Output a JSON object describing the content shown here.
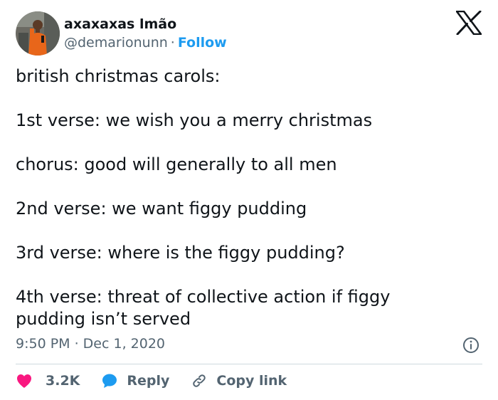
{
  "author": {
    "display_name": "axaxaxas lmão",
    "handle": "@demarionunn",
    "separator": "·",
    "follow_label": "Follow",
    "avatar": "avatar-photo-person-orange-jacket"
  },
  "logo": "x-logo-icon",
  "tweet": {
    "text": "british christmas carols:\n\n1st verse: we wish you a merry christmas\n\nchorus: good will generally to all men\n\n2nd verse: we want figgy pudding\n\n3rd verse: where is the figgy pudding?\n\n4th verse: threat of collective action if figgy\npudding isn’t served",
    "timestamp": "9:50 PM · Dec 1, 2020"
  },
  "actions": {
    "like_count": "3.2K",
    "reply_label": "Reply",
    "copy_link_label": "Copy link"
  },
  "colors": {
    "accent": "#1d9bf0",
    "like": "#f91880",
    "text": "#0f1419",
    "muted": "#536471",
    "divider": "#cfd9de"
  },
  "icons": [
    "x-logo-icon",
    "info-icon",
    "heart-icon",
    "reply-bubble-icon",
    "link-icon"
  ]
}
